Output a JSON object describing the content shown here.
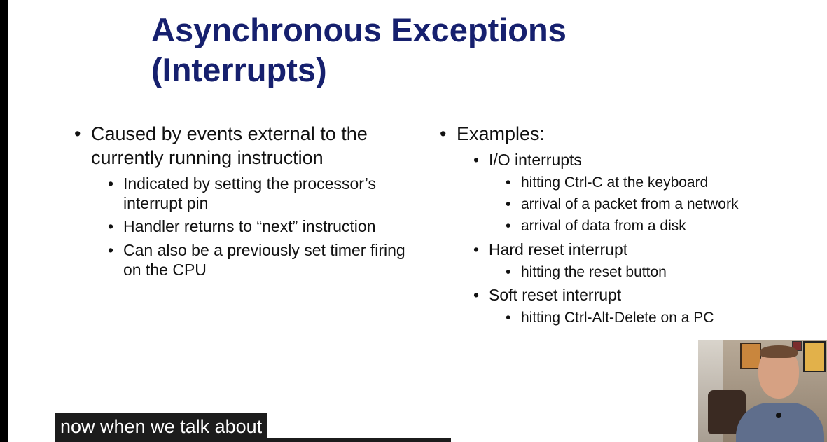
{
  "slide": {
    "title_line1": "Asynchronous Exceptions",
    "title_line2": "(Interrupts)",
    "bullet_char": "•",
    "left": {
      "main_line1": "Caused by events external to the",
      "main_line2": "currently running instruction",
      "sub1_line1": "Indicated by setting the processor’s",
      "sub1_line2": "interrupt pin",
      "sub2": "Handler returns to “next” instruction",
      "sub3_line1": "Can also be a previously set timer firing",
      "sub3_line2": "on the CPU"
    },
    "right": {
      "main": "Examples:",
      "io": "I/O interrupts",
      "io_1": "hitting Ctrl-C at the keyboard",
      "io_2": "arrival of a packet from a network",
      "io_3": "arrival of data from a disk",
      "hard": "Hard reset interrupt",
      "hard_1": "hitting the reset button",
      "soft": "Soft reset interrupt",
      "soft_1": "hitting Ctrl-Alt-Delete on a PC"
    }
  },
  "caption": {
    "text": "now when we talk about"
  },
  "colors": {
    "title": "#16206e",
    "body_text": "#111111",
    "caption_bg": "#1c1c1c",
    "caption_text": "#ffffff"
  }
}
